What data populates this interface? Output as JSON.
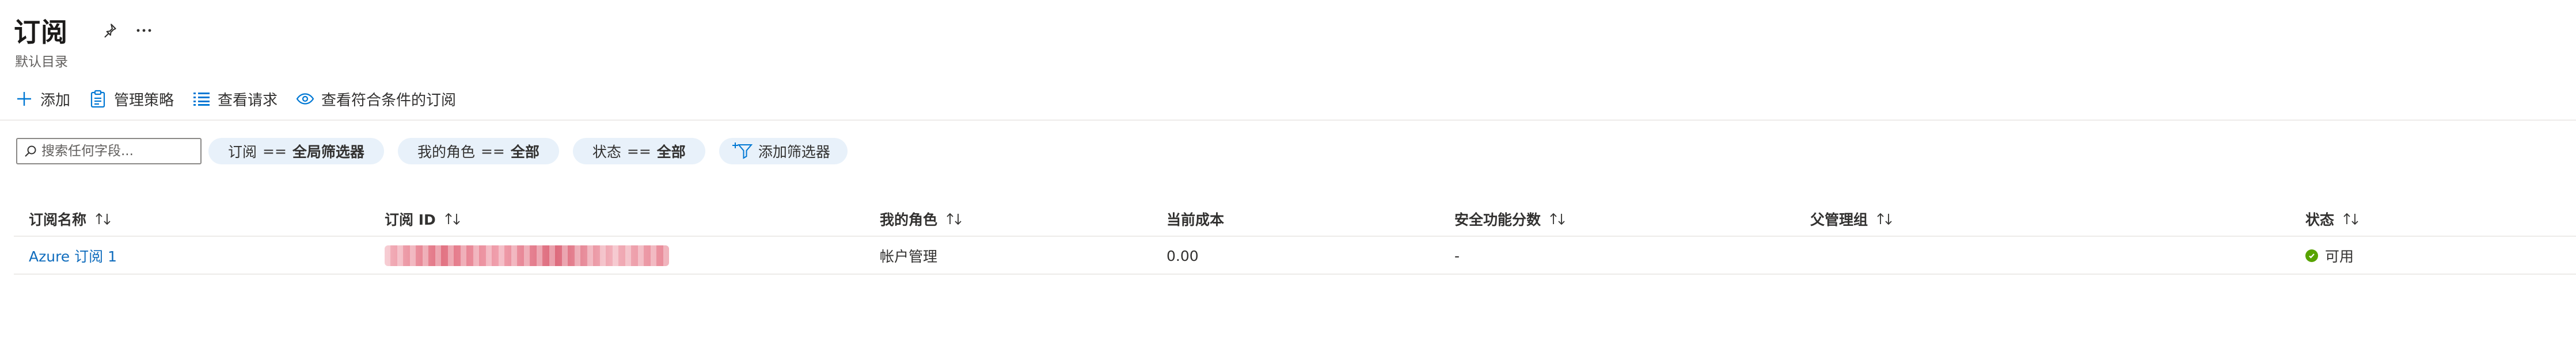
{
  "header": {
    "title": "订阅",
    "subtitle": "默认目录",
    "icons": [
      "pin-icon",
      "more-icon"
    ]
  },
  "toolbar": {
    "items": [
      {
        "label": "添加",
        "icon": "plus-icon"
      },
      {
        "label": "管理策略",
        "icon": "clipboard-icon"
      },
      {
        "label": "查看请求",
        "icon": "list-icon"
      },
      {
        "label": "查看符合条件的订阅",
        "icon": "eye-icon"
      }
    ]
  },
  "filters": {
    "search_placeholder": "搜索任何字段...",
    "pills": [
      {
        "key": "订阅",
        "op": "==",
        "value": "全局筛选器"
      },
      {
        "key": "我的角色",
        "op": "==",
        "value": "全部"
      },
      {
        "key": "状态",
        "op": "==",
        "value": "全部"
      }
    ],
    "add_filter_label": "添加筛选器"
  },
  "table": {
    "columns": [
      "订阅名称",
      "订阅 ID",
      "我的角色",
      "当前成本",
      "安全功能分数",
      "父管理组",
      "状态"
    ],
    "rows": [
      {
        "name": "Azure 订阅 1",
        "id": "",
        "role": "帐户管理",
        "cost": "0.00",
        "secure_score": "-",
        "parent_group": "",
        "status": "可用"
      }
    ]
  },
  "colors": {
    "link": "#0f6cbd",
    "pill_bg": "#e8f1fa",
    "status_ok": "#57a300",
    "accent": "#0078d4"
  }
}
